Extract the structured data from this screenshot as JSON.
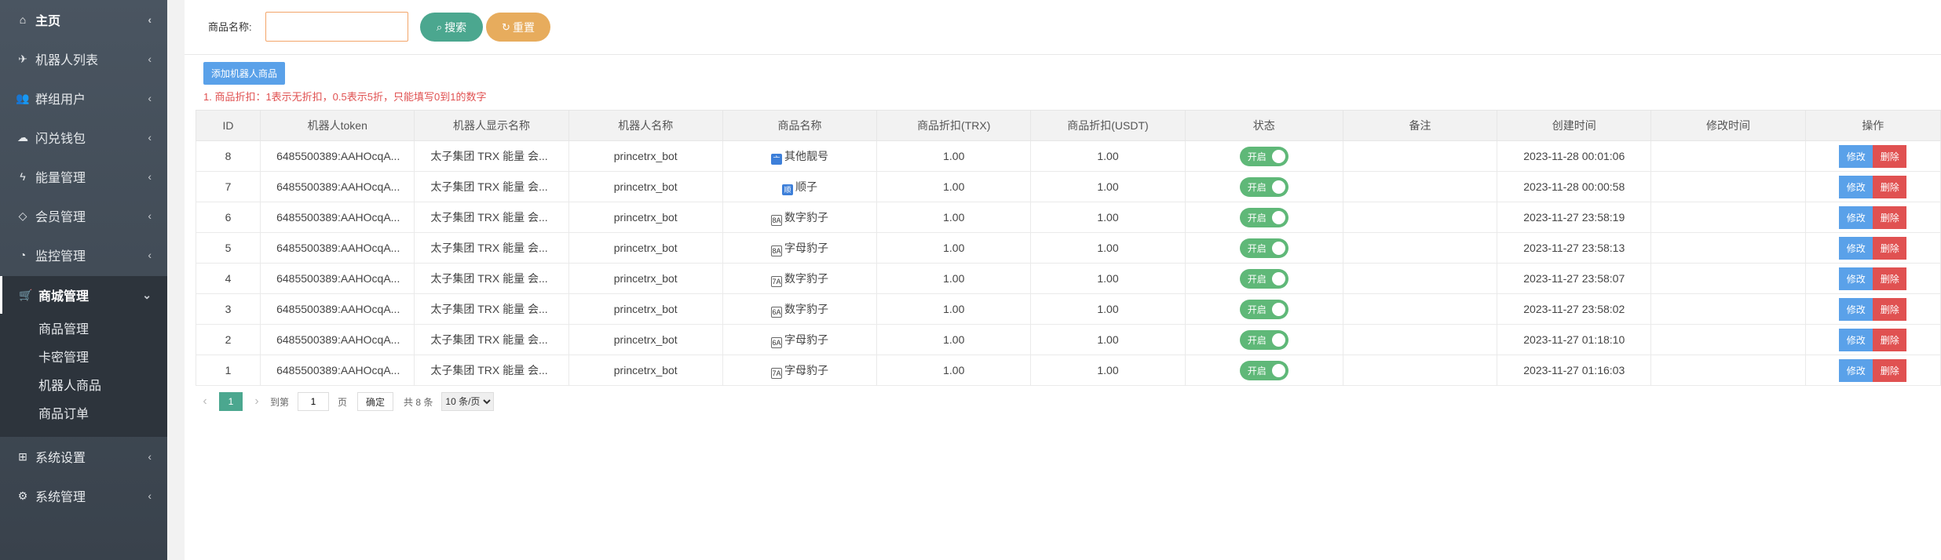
{
  "sidebar": {
    "items": [
      {
        "label": "主页",
        "icon": "home-icon"
      },
      {
        "label": "机器人列表",
        "icon": "plane-icon"
      },
      {
        "label": "群组用户",
        "icon": "users-icon"
      },
      {
        "label": "闪兑钱包",
        "icon": "cloud-icon"
      },
      {
        "label": "能量管理",
        "icon": "bolt-icon"
      },
      {
        "label": "会员管理",
        "icon": "diamond-icon"
      },
      {
        "label": "监控管理",
        "icon": "dashboard-icon"
      },
      {
        "label": "商城管理",
        "icon": "cart-icon"
      },
      {
        "label": "系统设置",
        "icon": "windows-icon"
      },
      {
        "label": "系统管理",
        "icon": "gear-icon"
      }
    ],
    "sub_items": [
      {
        "label": "商品管理"
      },
      {
        "label": "卡密管理"
      },
      {
        "label": "机器人商品"
      },
      {
        "label": "商品订单"
      }
    ]
  },
  "search": {
    "label": "商品名称:",
    "value": "",
    "search_button": "搜索",
    "reset_button": "重置"
  },
  "toolbar": {
    "add_button": "添加机器人商品",
    "hint": "1. 商品折扣：1表示无折扣，0.5表示5折，只能填写0到1的数字"
  },
  "table": {
    "headers": [
      "ID",
      "机器人token",
      "机器人显示名称",
      "机器人名称",
      "商品名称",
      "商品折扣(TRX)",
      "商品折扣(USDT)",
      "状态",
      "备注",
      "创建时间",
      "修改时间",
      "操作"
    ],
    "rows": [
      {
        "id": "8",
        "token": "6485500389:AAHOcqA...",
        "display": "太子集团 TRX 能量 会...",
        "bot": "princetrx_bot",
        "goods_icon": "亠",
        "goods": "其他靓号",
        "trx": "1.00",
        "usdt": "1.00",
        "status": "开启",
        "remark": "",
        "created": "2023-11-28 00:01:06",
        "modified": ""
      },
      {
        "id": "7",
        "token": "6485500389:AAHOcqA...",
        "display": "太子集团 TRX 能量 会...",
        "bot": "princetrx_bot",
        "goods_icon": "顺",
        "goods": "顺子",
        "trx": "1.00",
        "usdt": "1.00",
        "status": "开启",
        "remark": "",
        "created": "2023-11-28 00:00:58",
        "modified": ""
      },
      {
        "id": "6",
        "token": "6485500389:AAHOcqA...",
        "display": "太子集团 TRX 能量 会...",
        "bot": "princetrx_bot",
        "goods_icon": "8A",
        "goods": "数字豹子",
        "trx": "1.00",
        "usdt": "1.00",
        "status": "开启",
        "remark": "",
        "created": "2023-11-27 23:58:19",
        "modified": ""
      },
      {
        "id": "5",
        "token": "6485500389:AAHOcqA...",
        "display": "太子集团 TRX 能量 会...",
        "bot": "princetrx_bot",
        "goods_icon": "8A",
        "goods": "字母豹子",
        "trx": "1.00",
        "usdt": "1.00",
        "status": "开启",
        "remark": "",
        "created": "2023-11-27 23:58:13",
        "modified": ""
      },
      {
        "id": "4",
        "token": "6485500389:AAHOcqA...",
        "display": "太子集团 TRX 能量 会...",
        "bot": "princetrx_bot",
        "goods_icon": "7A",
        "goods": "数字豹子",
        "trx": "1.00",
        "usdt": "1.00",
        "status": "开启",
        "remark": "",
        "created": "2023-11-27 23:58:07",
        "modified": ""
      },
      {
        "id": "3",
        "token": "6485500389:AAHOcqA...",
        "display": "太子集团 TRX 能量 会...",
        "bot": "princetrx_bot",
        "goods_icon": "6A",
        "goods": "数字豹子",
        "trx": "1.00",
        "usdt": "1.00",
        "status": "开启",
        "remark": "",
        "created": "2023-11-27 23:58:02",
        "modified": ""
      },
      {
        "id": "2",
        "token": "6485500389:AAHOcqA...",
        "display": "太子集团 TRX 能量 会...",
        "bot": "princetrx_bot",
        "goods_icon": "6A",
        "goods": "字母豹子",
        "trx": "1.00",
        "usdt": "1.00",
        "status": "开启",
        "remark": "",
        "created": "2023-11-27 01:18:10",
        "modified": ""
      },
      {
        "id": "1",
        "token": "6485500389:AAHOcqA...",
        "display": "太子集团 TRX 能量 会...",
        "bot": "princetrx_bot",
        "goods_icon": "7A",
        "goods": "字母豹子",
        "trx": "1.00",
        "usdt": "1.00",
        "status": "开启",
        "remark": "",
        "created": "2023-11-27 01:16:03",
        "modified": ""
      }
    ],
    "edit_label": "修改",
    "delete_label": "删除"
  },
  "pager": {
    "current": "1",
    "goto_label": "到第",
    "page_value": "1",
    "page_unit": "页",
    "confirm": "确定",
    "total": "共 8 条",
    "page_size": "10 条/页"
  },
  "colors": {
    "primary_green": "#4ba78f",
    "accent_orange": "#e7ac5d",
    "blue": "#5aa1e9",
    "red": "#e05151",
    "switch_green": "#5fb878",
    "sidebar_dark": "#39424c"
  }
}
